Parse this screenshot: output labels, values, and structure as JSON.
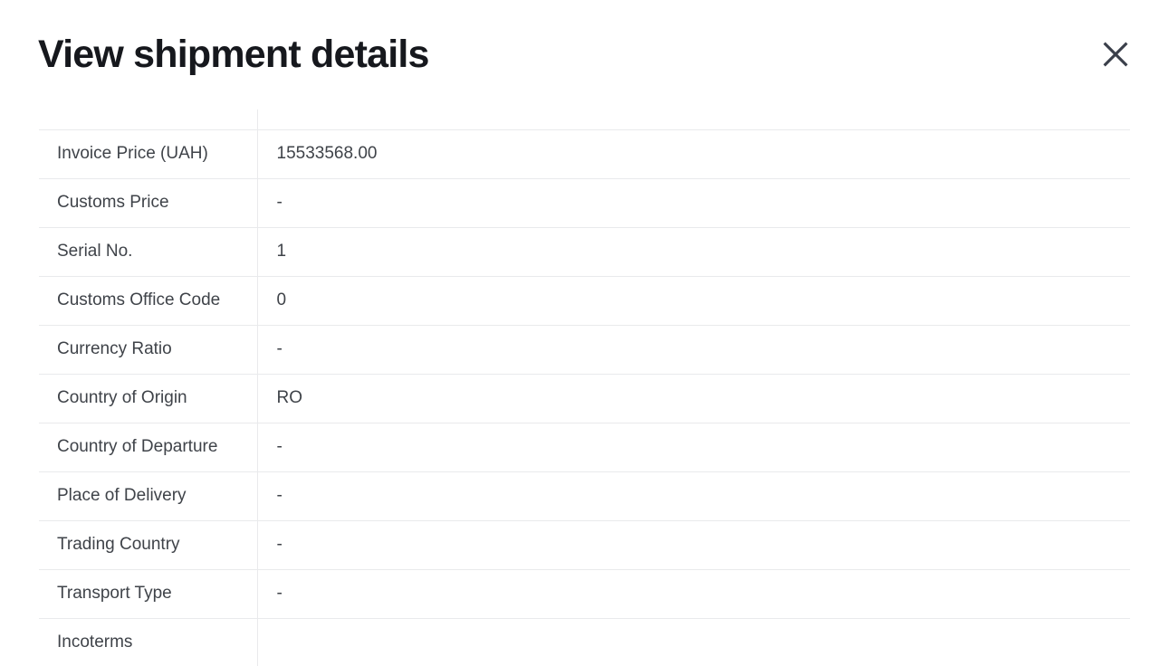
{
  "header": {
    "title": "View shipment details",
    "close_icon": "close-icon",
    "close_label": "Close"
  },
  "table": {
    "rows": [
      {
        "label": "Invoice Price (UAH)",
        "value": "15533568.00"
      },
      {
        "label": "Customs Price",
        "value": "-"
      },
      {
        "label": "Serial No.",
        "value": "1"
      },
      {
        "label": "Customs Office Code",
        "value": "0"
      },
      {
        "label": "Currency Ratio",
        "value": "-"
      },
      {
        "label": "Country of Origin",
        "value": "RO"
      },
      {
        "label": "Country of Departure",
        "value": "-"
      },
      {
        "label": "Place of Delivery",
        "value": "-"
      },
      {
        "label": "Trading Country",
        "value": "-"
      },
      {
        "label": "Transport Type",
        "value": "-"
      },
      {
        "label": "Incoterms",
        "value": ""
      }
    ]
  },
  "colors": {
    "background": "#ffffff",
    "title": "#16181d",
    "text": "#3f4349",
    "border": "#e9eaec",
    "icon": "#3a3f4a"
  }
}
